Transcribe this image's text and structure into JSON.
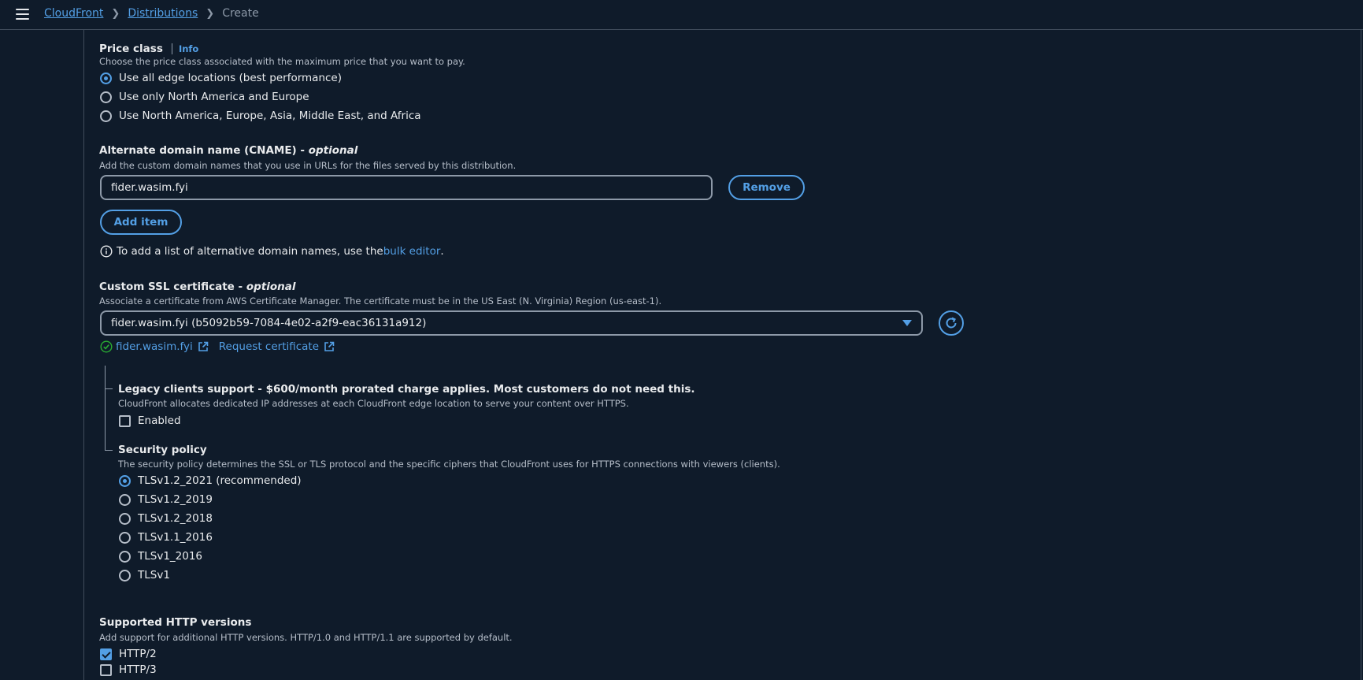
{
  "breadcrumb": {
    "items": [
      "CloudFront",
      "Distributions"
    ],
    "current": "Create"
  },
  "price_class": {
    "label": "Price class",
    "info": "Info",
    "description": "Choose the price class associated with the maximum price that you want to pay.",
    "options": [
      "Use all edge locations (best performance)",
      "Use only North America and Europe",
      "Use North America, Europe, Asia, Middle East, and Africa"
    ],
    "selected": 0
  },
  "cname": {
    "label": "Alternate domain name (CNAME) - ",
    "optional": "optional",
    "description": "Add the custom domain names that you use in URLs for the files served by this distribution.",
    "value": "fider.wasim.fyi",
    "remove_label": "Remove",
    "add_label": "Add item",
    "hint_prefix": "To add a list of alternative domain names, use the ",
    "hint_link": "bulk editor",
    "hint_suffix": "."
  },
  "ssl": {
    "label": "Custom SSL certificate - ",
    "optional": "optional",
    "description": "Associate a certificate from AWS Certificate Manager. The certificate must be in the US East (N. Virginia) Region (us-east-1).",
    "selected_value": "fider.wasim.fyi (b5092b59-7084-4e02-a2f9-eac36131a912)",
    "cert_link": "fider.wasim.fyi",
    "request_link": "Request certificate"
  },
  "legacy": {
    "label": "Legacy clients support - $600/month prorated charge applies. Most customers do not need this.",
    "description": "CloudFront allocates dedicated IP addresses at each CloudFront edge location to serve your content over HTTPS.",
    "checkbox_label": "Enabled",
    "checked": false
  },
  "security_policy": {
    "label": "Security policy",
    "description": "The security policy determines the SSL or TLS protocol and the specific ciphers that CloudFront uses for HTTPS connections with viewers (clients).",
    "options": [
      "TLSv1.2_2021 (recommended)",
      "TLSv1.2_2019",
      "TLSv1.2_2018",
      "TLSv1.1_2016",
      "TLSv1_2016",
      "TLSv1"
    ],
    "selected": 0
  },
  "http_versions": {
    "label": "Supported HTTP versions",
    "description": "Add support for additional HTTP versions. HTTP/1.0 and HTTP/1.1 are supported by default.",
    "options": [
      {
        "label": "HTTP/2",
        "checked": true
      },
      {
        "label": "HTTP/3",
        "checked": false
      }
    ]
  },
  "colors": {
    "background": "#0f1b2a",
    "accent": "#539fe5",
    "success": "#29ad32",
    "border": "#414d5c"
  }
}
